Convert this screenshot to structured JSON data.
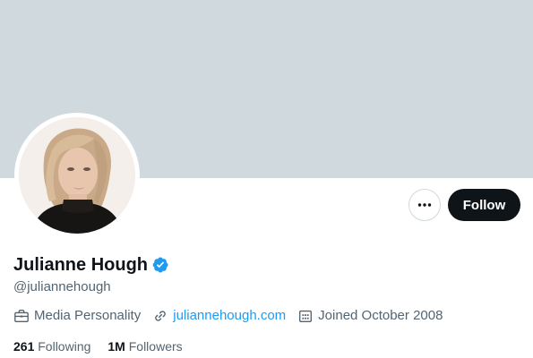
{
  "profile": {
    "display_name": "Julianne Hough",
    "handle": "@juliannehough",
    "verified": true,
    "category": "Media Personality",
    "website": "juliannehough.com",
    "joined": "Joined October 2008",
    "following_count": "261",
    "following_label": "Following",
    "followers_count": "1M",
    "followers_label": "Followers"
  },
  "actions": {
    "follow_label": "Follow",
    "more_icon": "more-horizontal-icon"
  },
  "icons": {
    "category": "briefcase-icon",
    "website": "link-icon",
    "joined": "calendar-icon",
    "verified": "verified-badge-icon"
  },
  "colors": {
    "banner": "#cfd9de",
    "link": "#1d9bf0",
    "verified": "#1d9bf0",
    "follow_button_bg": "#0f1419",
    "secondary_text": "#536471"
  }
}
